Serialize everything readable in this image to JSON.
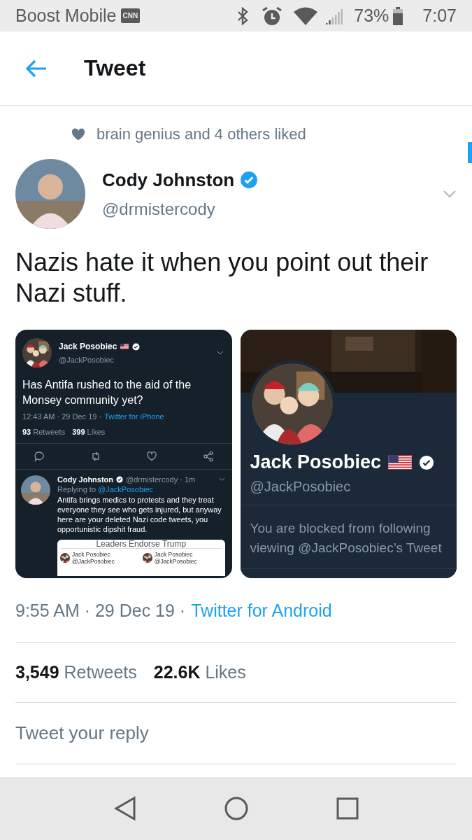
{
  "status_bar": {
    "carrier": "Boost Mobile",
    "notification": "CNN",
    "battery": "73%",
    "time": "7:07"
  },
  "header": {
    "title": "Tweet"
  },
  "social_context": "brain genius and 4 others liked",
  "tweet": {
    "author": {
      "name": "Cody Johnston",
      "handle": "@drmistercody"
    },
    "text": "Nazis hate it when you point out their Nazi stuff.",
    "media": [
      {
        "kind": "tweet_screenshot",
        "name": "Jack Posobiec",
        "handle": "@JackPosobiec",
        "text": "Has Antifa rushed to the aid of the Monsey community yet?",
        "meta": "12:43 AM · 29 Dec 19 ·",
        "source": "Twitter for iPhone",
        "stats": [
          {
            "count": "93",
            "label": "Retweets"
          },
          {
            "count": "399",
            "label": "Likes"
          }
        ],
        "reply": {
          "name": "Cody Johnston",
          "handle_time": "@drmistercody · 1m",
          "replying_prefix": "Replying to",
          "replying_to": "@JackPosobiec",
          "text": "Antifa brings medics to protests and they treat everyone they see who gets injured, but anyway here are your deleted Nazi code tweets, you opportunistic dipshit fraud.",
          "embed": {
            "headline": "Leaders Endorse Trump",
            "cards": [
              {
                "name": "Jack Posobiec",
                "handle": "@JackPosobiec"
              },
              {
                "name": "Jack Posobiec",
                "handle": "@JackPosobiec"
              }
            ]
          }
        }
      },
      {
        "kind": "profile_screenshot",
        "name": "Jack Posobiec",
        "handle": "@JackPosobiec",
        "blocked_lines": [
          "You are blocked from following",
          "viewing @JackPosobiec’s Tweet"
        ]
      }
    ],
    "meta": "9:55 AM · 29 Dec 19 ·",
    "source": "Twitter for Android",
    "stats": [
      {
        "count": "3,549",
        "label": "Retweets"
      },
      {
        "count": "22.6K",
        "label": "Likes"
      }
    ]
  },
  "reply": {
    "placeholder": "Tweet your reply"
  }
}
